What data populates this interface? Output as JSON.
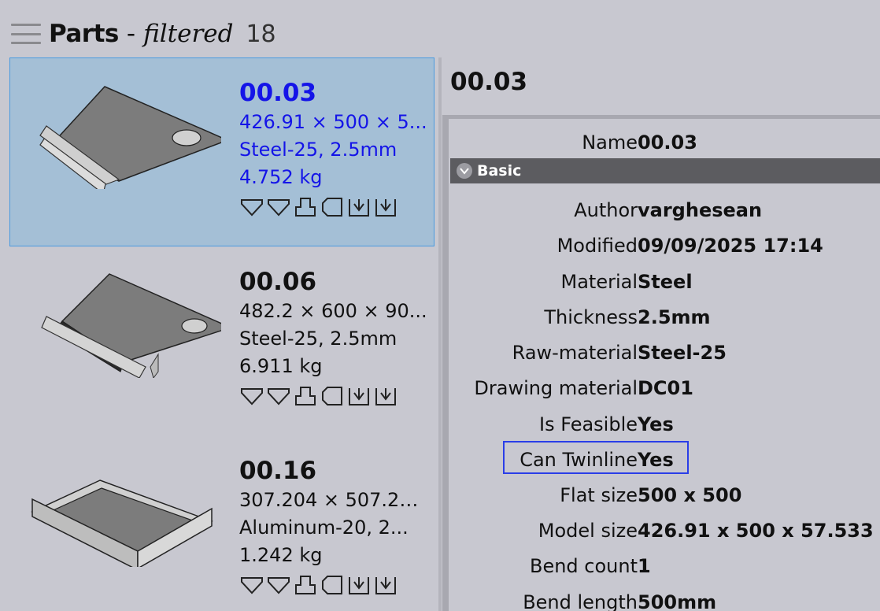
{
  "header": {
    "title": "Parts",
    "separator": "-",
    "filter": "filtered",
    "count": "18"
  },
  "parts": [
    {
      "name": "00.03",
      "dimensions": "426.91 × 500 × 5...",
      "material": "Steel-25, 2.5mm",
      "weight": "4.752 kg",
      "selected": true
    },
    {
      "name": "00.06",
      "dimensions": "482.2 × 600 × 90...",
      "material": "Steel-25, 2.5mm",
      "weight": "6.911 kg",
      "selected": false
    },
    {
      "name": "00.16",
      "dimensions": "307.204 × 507.20...",
      "material": "Aluminum-20, 2...",
      "weight": "1.242 kg",
      "selected": false
    }
  ],
  "detail": {
    "title": "00.03",
    "name_label": "Name",
    "name_value": "00.03",
    "section": "Basic",
    "properties": [
      {
        "label": "Author",
        "value": "varghesean"
      },
      {
        "label": "Modified",
        "value": "09/09/2025 17:14"
      },
      {
        "label": "Material",
        "value": "Steel"
      },
      {
        "label": "Thickness",
        "value": "2.5mm"
      },
      {
        "label": "Raw-material",
        "value": "Steel-25"
      },
      {
        "label": "Drawing material",
        "value": "DC01"
      },
      {
        "label": "Is Feasible",
        "value": "Yes"
      },
      {
        "label": "Can Twinline",
        "value": "Yes"
      },
      {
        "label": "Flat size",
        "value": "500 x 500"
      },
      {
        "label": "Model size",
        "value": "426.91 x 500 x 57.533"
      },
      {
        "label": "Bend count",
        "value": "1"
      },
      {
        "label": "Bend length",
        "value": "500mm"
      }
    ]
  },
  "colors": {
    "background": "#c8c8d0",
    "selected_bg": "#a4bfd6",
    "selected_text": "#1414e8",
    "section_header": "#5c5c60",
    "focus_border": "#2a3ee8"
  }
}
